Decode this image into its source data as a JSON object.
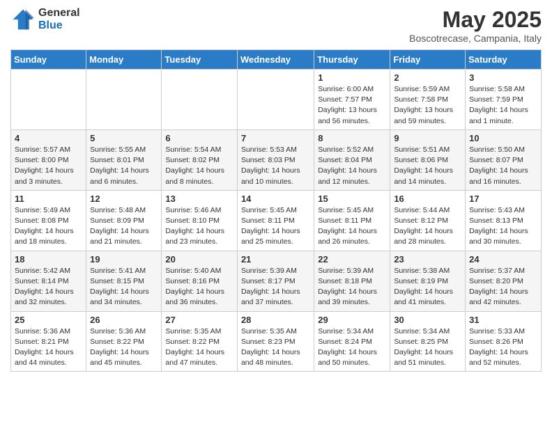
{
  "header": {
    "logo_general": "General",
    "logo_blue": "Blue",
    "month_year": "May 2025",
    "location": "Boscotrecase, Campania, Italy"
  },
  "weekdays": [
    "Sunday",
    "Monday",
    "Tuesday",
    "Wednesday",
    "Thursday",
    "Friday",
    "Saturday"
  ],
  "weeks": [
    [
      {
        "day": "",
        "info": ""
      },
      {
        "day": "",
        "info": ""
      },
      {
        "day": "",
        "info": ""
      },
      {
        "day": "",
        "info": ""
      },
      {
        "day": "1",
        "info": "Sunrise: 6:00 AM\nSunset: 7:57 PM\nDaylight: 13 hours\nand 56 minutes."
      },
      {
        "day": "2",
        "info": "Sunrise: 5:59 AM\nSunset: 7:58 PM\nDaylight: 13 hours\nand 59 minutes."
      },
      {
        "day": "3",
        "info": "Sunrise: 5:58 AM\nSunset: 7:59 PM\nDaylight: 14 hours\nand 1 minute."
      }
    ],
    [
      {
        "day": "4",
        "info": "Sunrise: 5:57 AM\nSunset: 8:00 PM\nDaylight: 14 hours\nand 3 minutes."
      },
      {
        "day": "5",
        "info": "Sunrise: 5:55 AM\nSunset: 8:01 PM\nDaylight: 14 hours\nand 6 minutes."
      },
      {
        "day": "6",
        "info": "Sunrise: 5:54 AM\nSunset: 8:02 PM\nDaylight: 14 hours\nand 8 minutes."
      },
      {
        "day": "7",
        "info": "Sunrise: 5:53 AM\nSunset: 8:03 PM\nDaylight: 14 hours\nand 10 minutes."
      },
      {
        "day": "8",
        "info": "Sunrise: 5:52 AM\nSunset: 8:04 PM\nDaylight: 14 hours\nand 12 minutes."
      },
      {
        "day": "9",
        "info": "Sunrise: 5:51 AM\nSunset: 8:06 PM\nDaylight: 14 hours\nand 14 minutes."
      },
      {
        "day": "10",
        "info": "Sunrise: 5:50 AM\nSunset: 8:07 PM\nDaylight: 14 hours\nand 16 minutes."
      }
    ],
    [
      {
        "day": "11",
        "info": "Sunrise: 5:49 AM\nSunset: 8:08 PM\nDaylight: 14 hours\nand 18 minutes."
      },
      {
        "day": "12",
        "info": "Sunrise: 5:48 AM\nSunset: 8:09 PM\nDaylight: 14 hours\nand 21 minutes."
      },
      {
        "day": "13",
        "info": "Sunrise: 5:46 AM\nSunset: 8:10 PM\nDaylight: 14 hours\nand 23 minutes."
      },
      {
        "day": "14",
        "info": "Sunrise: 5:45 AM\nSunset: 8:11 PM\nDaylight: 14 hours\nand 25 minutes."
      },
      {
        "day": "15",
        "info": "Sunrise: 5:45 AM\nSunset: 8:11 PM\nDaylight: 14 hours\nand 26 minutes."
      },
      {
        "day": "16",
        "info": "Sunrise: 5:44 AM\nSunset: 8:12 PM\nDaylight: 14 hours\nand 28 minutes."
      },
      {
        "day": "17",
        "info": "Sunrise: 5:43 AM\nSunset: 8:13 PM\nDaylight: 14 hours\nand 30 minutes."
      }
    ],
    [
      {
        "day": "18",
        "info": "Sunrise: 5:42 AM\nSunset: 8:14 PM\nDaylight: 14 hours\nand 32 minutes."
      },
      {
        "day": "19",
        "info": "Sunrise: 5:41 AM\nSunset: 8:15 PM\nDaylight: 14 hours\nand 34 minutes."
      },
      {
        "day": "20",
        "info": "Sunrise: 5:40 AM\nSunset: 8:16 PM\nDaylight: 14 hours\nand 36 minutes."
      },
      {
        "day": "21",
        "info": "Sunrise: 5:39 AM\nSunset: 8:17 PM\nDaylight: 14 hours\nand 37 minutes."
      },
      {
        "day": "22",
        "info": "Sunrise: 5:39 AM\nSunset: 8:18 PM\nDaylight: 14 hours\nand 39 minutes."
      },
      {
        "day": "23",
        "info": "Sunrise: 5:38 AM\nSunset: 8:19 PM\nDaylight: 14 hours\nand 41 minutes."
      },
      {
        "day": "24",
        "info": "Sunrise: 5:37 AM\nSunset: 8:20 PM\nDaylight: 14 hours\nand 42 minutes."
      }
    ],
    [
      {
        "day": "25",
        "info": "Sunrise: 5:36 AM\nSunset: 8:21 PM\nDaylight: 14 hours\nand 44 minutes."
      },
      {
        "day": "26",
        "info": "Sunrise: 5:36 AM\nSunset: 8:22 PM\nDaylight: 14 hours\nand 45 minutes."
      },
      {
        "day": "27",
        "info": "Sunrise: 5:35 AM\nSunset: 8:22 PM\nDaylight: 14 hours\nand 47 minutes."
      },
      {
        "day": "28",
        "info": "Sunrise: 5:35 AM\nSunset: 8:23 PM\nDaylight: 14 hours\nand 48 minutes."
      },
      {
        "day": "29",
        "info": "Sunrise: 5:34 AM\nSunset: 8:24 PM\nDaylight: 14 hours\nand 50 minutes."
      },
      {
        "day": "30",
        "info": "Sunrise: 5:34 AM\nSunset: 8:25 PM\nDaylight: 14 hours\nand 51 minutes."
      },
      {
        "day": "31",
        "info": "Sunrise: 5:33 AM\nSunset: 8:26 PM\nDaylight: 14 hours\nand 52 minutes."
      }
    ]
  ]
}
